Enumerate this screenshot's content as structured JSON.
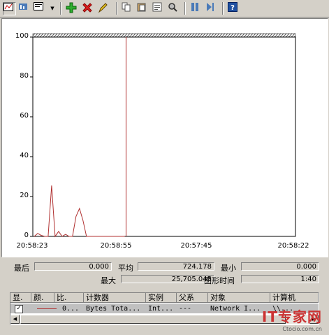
{
  "toolbar": {
    "items": [
      "view-graph-icon",
      "view-histogram-icon",
      "view-report-icon",
      "dropdown-icon",
      "add-counter-icon",
      "delete-counter-icon",
      "highlight-icon",
      "copy-icon",
      "paste-icon",
      "properties-icon",
      "zoom-icon",
      "freeze-icon",
      "update-icon",
      "help-icon"
    ]
  },
  "chart_data": {
    "type": "line",
    "y_ticks": [
      "100",
      "80",
      "60",
      "40",
      "20",
      "0"
    ],
    "x_ticks": [
      "20:58:23",
      "20:58:55",
      "20:57:45",
      "20:58:22"
    ],
    "ylim": [
      0,
      100
    ],
    "grid": false,
    "series": [
      {
        "color": "#b03030",
        "values": [
          0,
          1.5,
          0.5,
          0,
          0,
          25.5,
          0,
          2.5,
          0,
          1,
          0,
          0,
          10,
          14,
          8,
          0,
          0,
          0,
          0,
          0,
          0,
          0,
          0,
          0,
          0,
          0,
          0
        ]
      }
    ],
    "cursor_fraction": 0.355
  },
  "stats": {
    "last_label": "最后",
    "last_value": "0.000",
    "avg_label": "平均",
    "avg_value": "724.178",
    "min_label": "最小",
    "min_value": "0.000",
    "max_label": "最大",
    "max_value": "25,705.045",
    "duration_label": "图形时间",
    "duration_value": "1:40"
  },
  "counter_list": {
    "headers": [
      "显.",
      "颜.",
      "比.",
      "计数器",
      "实例",
      "父系",
      "对象",
      "计算机"
    ],
    "row": {
      "checked": "✓",
      "scale": "0...",
      "counter": "Bytes Tota...",
      "instance": "Int...",
      "parent": "---",
      "object": "Network I...",
      "computer": "\\\\..."
    }
  },
  "watermark": {
    "brand": "IT专家网",
    "url": "Ctocio.com.cn"
  }
}
